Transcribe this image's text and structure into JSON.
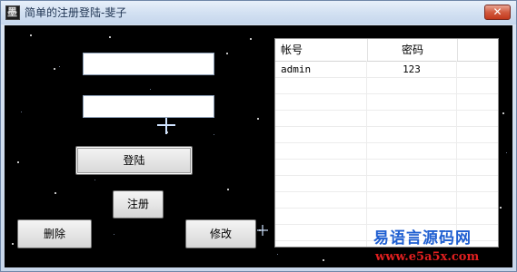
{
  "window": {
    "title": "简单的注册登陆-斐子",
    "app_icon_glyph": "墨",
    "close_glyph": "✕"
  },
  "form": {
    "username_value": "",
    "password_value": "",
    "login_label": "登陆",
    "register_label": "注册",
    "delete_label": "删除",
    "modify_label": "修改"
  },
  "table": {
    "columns": [
      "帐号",
      "密码"
    ],
    "rows": [
      {
        "account": "admin",
        "password": "123"
      }
    ]
  },
  "watermark": {
    "line1": "易语言源码网",
    "line2": "www.e5a5x.com"
  },
  "colors": {
    "titlebar": "#d3e1f2",
    "close_button": "#c1381c",
    "starfield": "#000000",
    "watermark_blue": "#1f5fd1",
    "watermark_red": "#e01f1f"
  }
}
